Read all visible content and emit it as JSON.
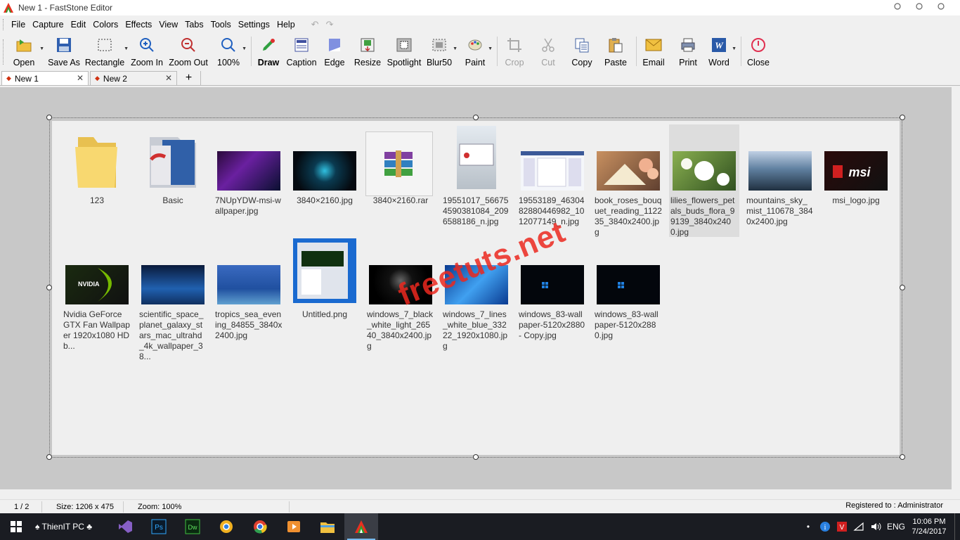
{
  "window": {
    "title": "New 1 - FastStone Editor"
  },
  "menu": [
    "File",
    "Capture",
    "Edit",
    "Colors",
    "Effects",
    "View",
    "Tabs",
    "Tools",
    "Settings",
    "Help"
  ],
  "toolbar": {
    "open": "Open",
    "save_as": "Save As",
    "rectangle": "Rectangle",
    "zoom_in": "Zoom In",
    "zoom_out": "Zoom Out",
    "zoom_level": "100%",
    "draw": "Draw",
    "caption": "Caption",
    "edge": "Edge",
    "resize": "Resize",
    "spotlight": "Spotlight",
    "blur": "Blur50",
    "paint": "Paint",
    "crop": "Crop",
    "cut": "Cut",
    "copy": "Copy",
    "paste": "Paste",
    "email": "Email",
    "print": "Print",
    "word": "Word",
    "close": "Close"
  },
  "tabs": [
    {
      "label": "New 1",
      "active": true
    },
    {
      "label": "New 2",
      "active": false
    }
  ],
  "tab_add": "+",
  "files": [
    {
      "name": "123",
      "kind": "folder"
    },
    {
      "name": "Basic",
      "kind": "folder-app"
    },
    {
      "name": "7NUpYDW-msi-wallpaper.jpg",
      "kind": "image",
      "color": "#3a1030"
    },
    {
      "name": "3840×2160.jpg",
      "kind": "image",
      "color": "#0a2a3a"
    },
    {
      "name": "3840×2160.rar",
      "kind": "rar"
    },
    {
      "name": "19551017_566754590381084_2096588186_n.jpg",
      "kind": "image-tall",
      "color": "#c8d4de"
    },
    {
      "name": "19553189_4630482880446982_1012077149_n.jpg",
      "kind": "image",
      "color": "#e8ecf4"
    },
    {
      "name": "book_roses_bouquet_reading_112235_3840x2400.jpg",
      "kind": "image",
      "color": "#b08050"
    },
    {
      "name": "lilies_flowers_petals_buds_flora_99139_3840x2400.jpg",
      "kind": "image",
      "color": "#6a9a40"
    },
    {
      "name": "mountains_sky_mist_110678_3840x2400.jpg",
      "kind": "image",
      "color": "#4a6a8c"
    },
    {
      "name": "msi_logo.jpg",
      "kind": "image",
      "color": "#2a0a0a"
    },
    {
      "name": "Nvidia GeForce GTX Fan Wallpaper 1920x1080 HD b...",
      "kind": "image",
      "color": "#1a2a10"
    },
    {
      "name": "scientific_space_planet_galaxy_stars_mac_ultrahd_4k_wallpaper_38...",
      "kind": "image",
      "color": "#1a3a6a"
    },
    {
      "name": "tropics_sea_evening_84855_3840x2400.jpg",
      "kind": "image",
      "color": "#204a8a"
    },
    {
      "name": "Untitled.png",
      "kind": "image-screenshot",
      "color": "#1a6ad0"
    },
    {
      "name": "windows_7_black_white_light_26540_3840x2400.jpg",
      "kind": "image",
      "color": "#0a0a0a"
    },
    {
      "name": "windows_7_lines_white_blue_33222_1920x1080.jpg",
      "kind": "image",
      "color": "#1a70d0"
    },
    {
      "name": "windows_83-wallpaper-5120x2880 - Copy.jpg",
      "kind": "image",
      "color": "#050810"
    },
    {
      "name": "windows_83-wallpaper-5120x2880.jpg",
      "kind": "image",
      "color": "#050810"
    }
  ],
  "watermark": "freetuts.net",
  "status": {
    "page": "1 / 2",
    "size": "Size: 1206 x 475",
    "zoom": "Zoom: 100%",
    "registered": "Registered to : Administrator"
  },
  "taskbar": {
    "pc_label": "ThienIT PC",
    "time": "10:06 PM",
    "date": "7/24/2017",
    "lang": "ENG"
  }
}
